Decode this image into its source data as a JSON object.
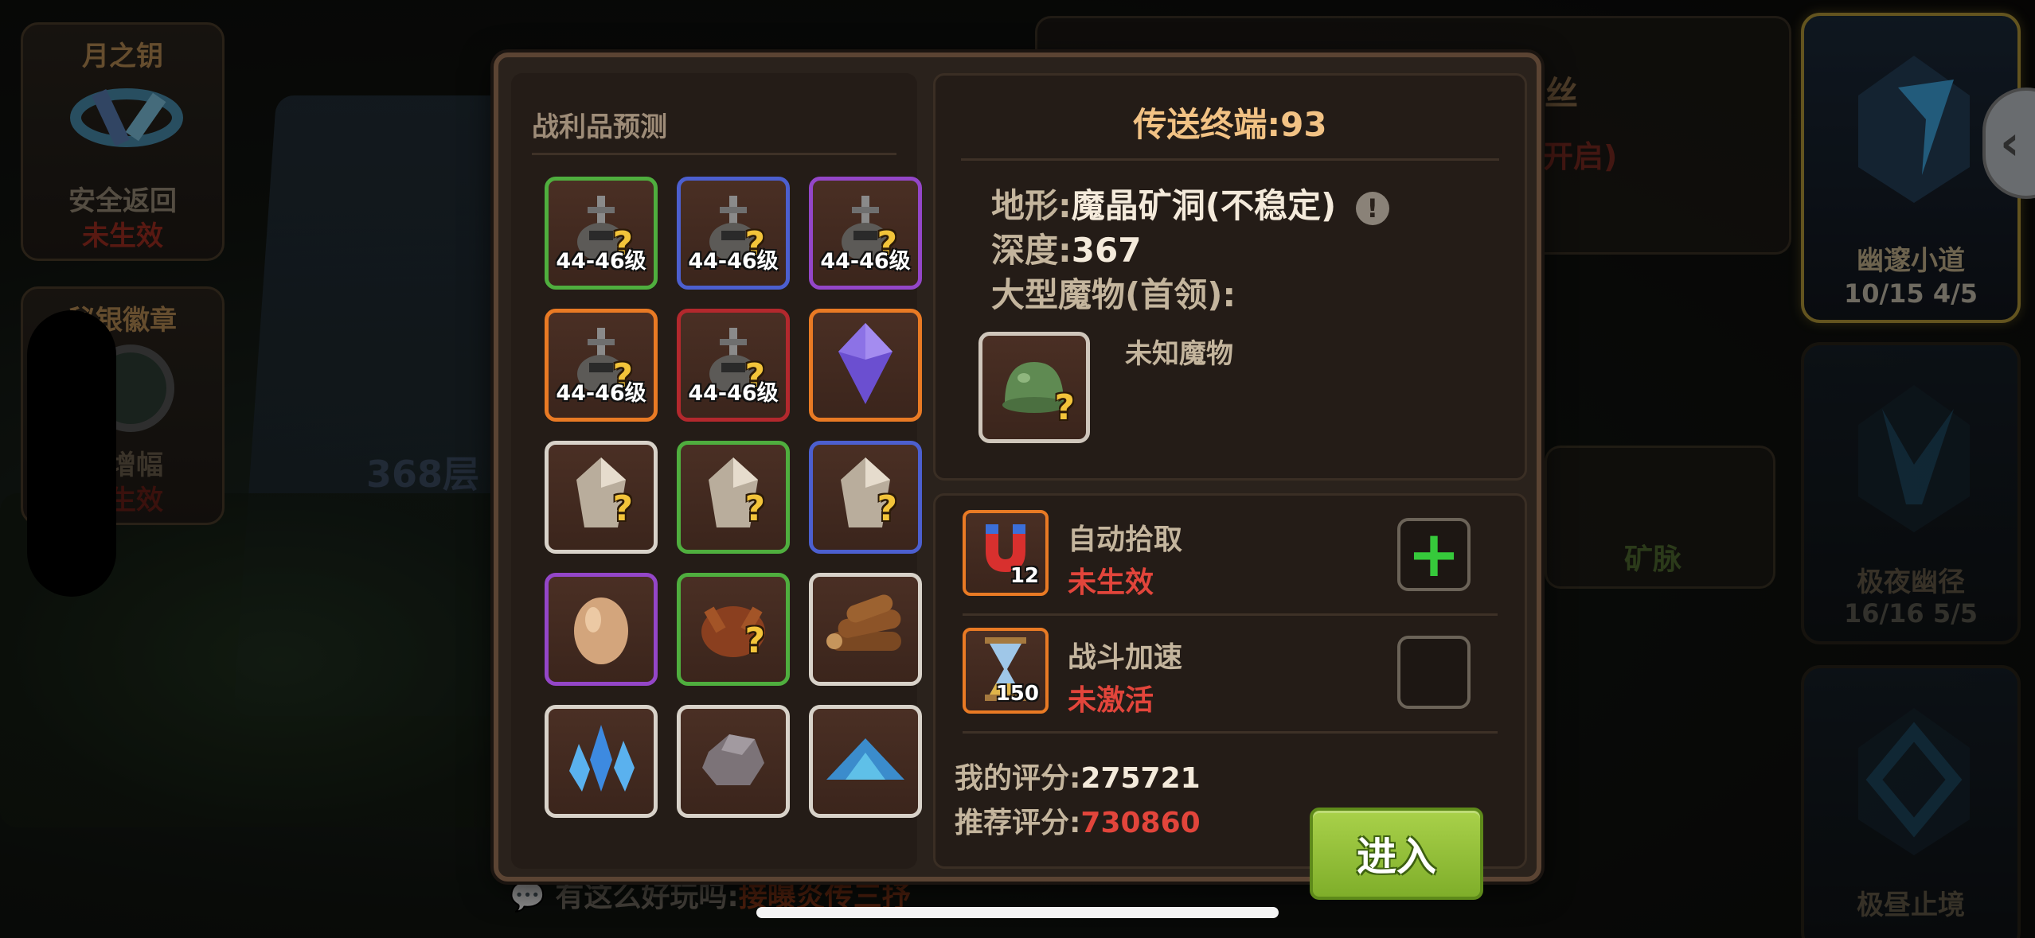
{
  "left_cards": [
    {
      "title": "月之钥",
      "label": "安全返回",
      "status": "未生效"
    },
    {
      "title": "秘银徽章",
      "label": "特增幅",
      "status": "未生效"
    }
  ],
  "background": {
    "map_text": "368层",
    "chat_prefix": "有这么好玩吗:",
    "chat_text": "接曝炎传三抒",
    "top_text": "丝",
    "top_sub": "未开启)",
    "mine_label": "矿脉"
  },
  "right_cards": [
    {
      "title": "幽邃小道",
      "stats": "10/15   4/5"
    },
    {
      "title": "极夜幽径",
      "stats": "16/16   5/5"
    },
    {
      "title": "极昼止境",
      "stats": ""
    }
  ],
  "loot": {
    "title": "战利品预测",
    "slots": [
      {
        "label": "44-46级",
        "icon": "gear-unknown-icon",
        "border": "#4fae3e"
      },
      {
        "label": "44-46级",
        "icon": "gear-unknown-icon",
        "border": "#4c5fcf"
      },
      {
        "label": "44-46级",
        "icon": "gear-unknown-icon",
        "border": "#9446c8"
      },
      {
        "label": "44-46级",
        "icon": "gear-unknown-icon",
        "border": "#e97a24"
      },
      {
        "label": "44-46级",
        "icon": "gear-unknown-icon",
        "border": "#b3282d"
      },
      {
        "label": "",
        "icon": "purple-crystal-icon",
        "border": "#e97a24"
      },
      {
        "label": "",
        "icon": "crystal-unknown-icon",
        "border": "#d8d2c9"
      },
      {
        "label": "",
        "icon": "crystal-unknown-icon",
        "border": "#4fae3e"
      },
      {
        "label": "",
        "icon": "crystal-unknown-icon",
        "border": "#4c5fcf"
      },
      {
        "label": "",
        "icon": "egg-icon",
        "border": "#9446c8"
      },
      {
        "label": "",
        "icon": "roast-chicken-unknown-icon",
        "border": "#4fae3e"
      },
      {
        "label": "",
        "icon": "wood-logs-icon",
        "border": "#d8d2c9"
      },
      {
        "label": "",
        "icon": "blue-crystal-cluster-icon",
        "border": "#d8d2c9"
      },
      {
        "label": "",
        "icon": "stone-ore-icon",
        "border": "#d8d2c9"
      },
      {
        "label": "",
        "icon": "gem-dust-icon",
        "border": "#d8d2c9"
      }
    ]
  },
  "info": {
    "portal_label": "传送终端:",
    "portal_value": "93",
    "terrain_label": "地形:",
    "terrain_value": "魔晶矿洞(不稳定)",
    "depth_label": "深度:",
    "depth_value": "367",
    "boss_label": "大型魔物(首领):",
    "monster_name": "未知魔物"
  },
  "options": {
    "auto_pick_name": "自动拾取",
    "auto_pick_status": "未生效",
    "auto_pick_count": "12",
    "speed_name": "战斗加速",
    "speed_status": "未激活",
    "speed_count": "150",
    "my_score_label": "我的评分:",
    "my_score": "275721",
    "rec_score_label": "推荐评分:",
    "rec_score": "730860",
    "enter_label": "进入"
  }
}
